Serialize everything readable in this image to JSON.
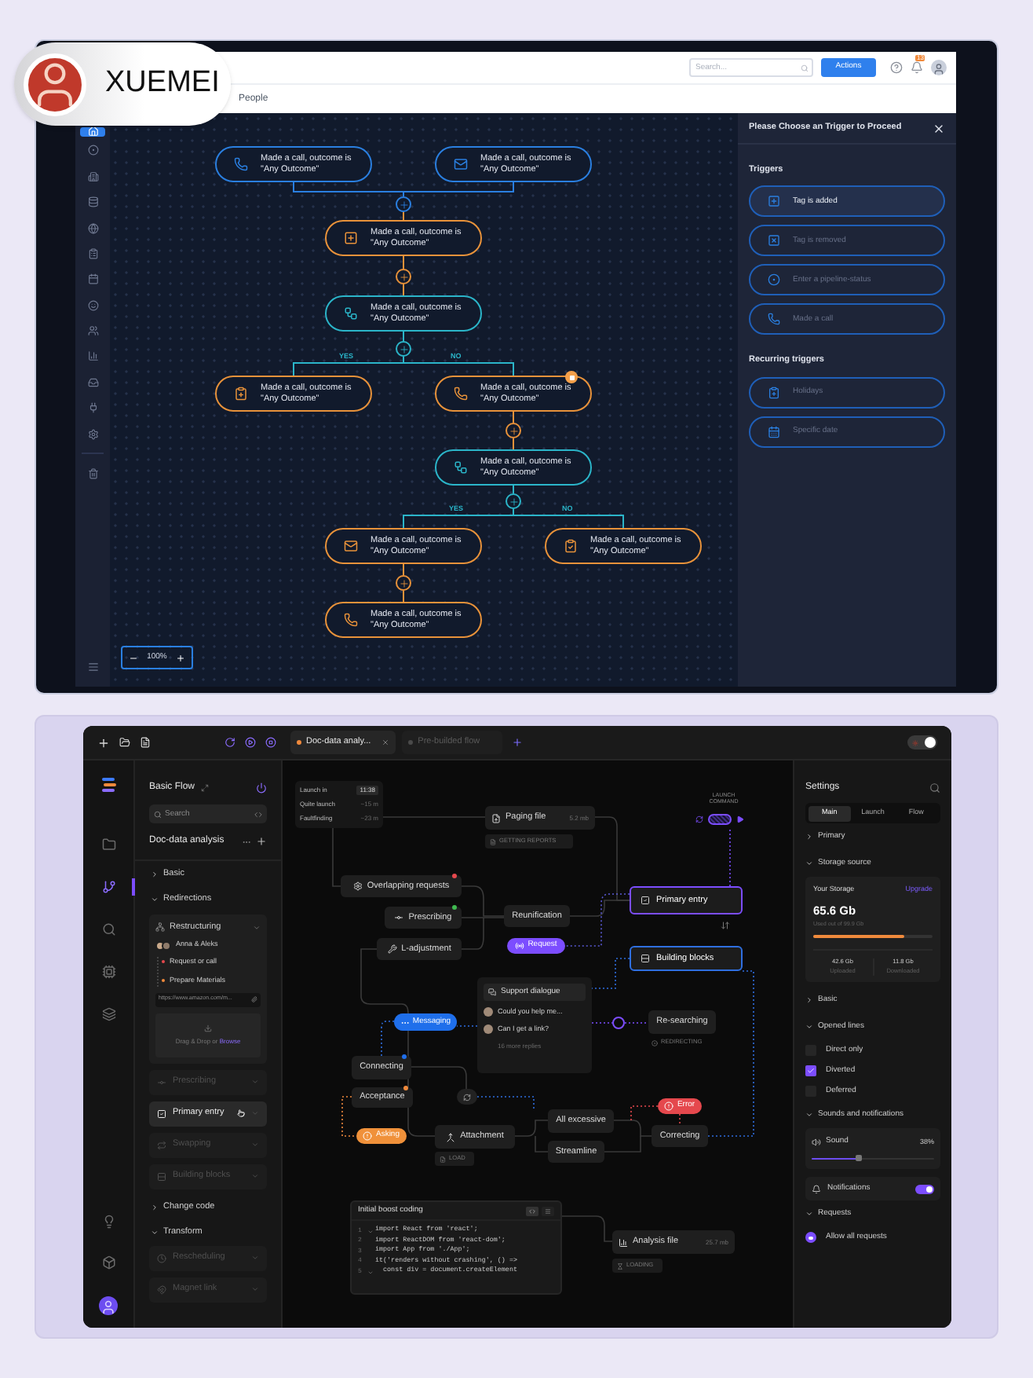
{
  "profile_badge": {
    "name": "XUEMEI"
  },
  "crm": {
    "search": {
      "placeholder": "Search..."
    },
    "actions_button": "Actions",
    "notification_count": "13",
    "breadcrumb": "People",
    "sidebar": [
      {
        "selected": true
      },
      {
        "selected": false
      },
      {
        "selected": false
      },
      {
        "selected": false
      },
      {
        "selected": false
      },
      {
        "selected": false
      },
      {
        "selected": false
      },
      {
        "selected": false
      },
      {
        "selected": false
      },
      {
        "selected": false
      },
      {
        "selected": false
      },
      {
        "selected": false
      },
      {
        "selected": false
      },
      {
        "selected": false
      }
    ],
    "flow": {
      "nodes": [
        {
          "kind": "call",
          "color": "#2a7fe0",
          "text": "Made a call, outcome is \"Any Outcome\"",
          "flagged": false
        },
        {
          "kind": "email",
          "color": "#2a7fe0",
          "text": "Made a call, outcome is \"Any Outcome\"",
          "flagged": false
        },
        {
          "kind": "tag",
          "color": "#e8923a",
          "text": "Made a call, outcome is \"Any Outcome\"",
          "flagged": false
        },
        {
          "kind": "split",
          "color": "#2bb5c9",
          "text": "Made a call, outcome is \"Any Outcome\"",
          "flagged": false
        },
        {
          "kind": "task",
          "color": "#e8923a",
          "text": "Made a call, outcome is \"Any Outcome\"",
          "flagged": false
        },
        {
          "kind": "call",
          "color": "#e8923a",
          "text": "Made a call, outcome is \"Any Outcome\"",
          "flagged": true
        },
        {
          "kind": "split",
          "color": "#2bb5c9",
          "text": "Made a call, outcome is \"Any Outcome\"",
          "flagged": false
        },
        {
          "kind": "email",
          "color": "#e8923a",
          "text": "Made a call, outcome is \"Any Outcome\"",
          "flagged": false
        },
        {
          "kind": "review",
          "color": "#e8923a",
          "text": "Made a call, outcome is \"Any Outcome\"",
          "flagged": false
        },
        {
          "kind": "call",
          "color": "#e8923a",
          "text": "Made a call, outcome is \"Any Outcome\"",
          "flagged": false
        }
      ],
      "branch_labels": [
        "YES",
        "NO",
        "YES",
        "NO"
      ],
      "zoom": "100%"
    },
    "trigger_panel": {
      "title": "Please Choose an Trigger to Proceed",
      "sections": [
        {
          "heading": "Triggers",
          "items": [
            {
              "label": "Tag is added",
              "selected": true
            },
            {
              "label": "Tag is removed",
              "selected": false
            },
            {
              "label": "Enter a pipeline-status",
              "selected": false
            },
            {
              "label": "Made a call",
              "selected": false
            }
          ]
        },
        {
          "heading": "Recurring triggers",
          "items": [
            {
              "label": "Holidays",
              "selected": false
            },
            {
              "label": "Specific date",
              "selected": false
            }
          ]
        }
      ]
    }
  },
  "studio": {
    "tabs": [
      {
        "label": "Doc-data analy...",
        "selected": true,
        "color": "#f08a3c",
        "closable": true
      },
      {
        "label": "Pre-builded flow",
        "selected": false,
        "color": "#4a4a4a",
        "closable": false
      }
    ],
    "theme_toggle": {
      "on": true
    },
    "rail": [
      {
        "selected": false
      },
      {
        "selected": true
      },
      {
        "selected": false
      },
      {
        "selected": false
      },
      {
        "selected": false
      }
    ],
    "panel": {
      "title": "Basic Flow",
      "search_placeholder": "Search",
      "project": "Doc-data analysis",
      "sections": [
        {
          "label": "Basic",
          "expanded": false
        },
        {
          "label": "Redirections",
          "expanded": true,
          "card": {
            "title": "Restructuring",
            "people": "Anna & Aleks",
            "steps": [
              {
                "label": "Request or call",
                "color": "#e5484d"
              },
              {
                "label": "Prepare Materials",
                "color": "#f08a3c"
              }
            ],
            "link": "https://www.amazon.com/m...",
            "dropzone": {
              "text": "Drag & Drop or",
              "link": "Browse"
            }
          },
          "items": [
            {
              "label": "Prescribing",
              "selected": false
            },
            {
              "label": "Primary entry",
              "selected": true
            },
            {
              "label": "Swapping",
              "selected": false
            },
            {
              "label": "Building blocks",
              "selected": false
            }
          ]
        },
        {
          "label": "Change code",
          "expanded": false
        },
        {
          "label": "Transform",
          "expanded": true,
          "items": [
            {
              "label": "Rescheduling",
              "selected": false
            },
            {
              "label": "Magnet link",
              "selected": false
            }
          ]
        }
      ]
    },
    "canvas": {
      "info": [
        {
          "label": "Launch in",
          "value": "11:38"
        },
        {
          "label": "Quite launch",
          "value": "~15 m"
        },
        {
          "label": "Faultfinding",
          "value": "~23 m"
        }
      ],
      "launch_label": "LAUNCH COMMAND",
      "launch_switch": {
        "on": true
      },
      "nodes": [
        {
          "kind": "file",
          "label": "Paging file",
          "meta": "5.2 mb"
        },
        {
          "kind": "tag",
          "label": "GETTING REPORTS"
        },
        {
          "kind": "node",
          "label": "Overlapping requests",
          "color": "#e5484d"
        },
        {
          "kind": "node",
          "label": "Prescribing",
          "color": "#3fb950"
        },
        {
          "kind": "node",
          "label": "Reunification"
        },
        {
          "kind": "node",
          "label": "L-adjustment"
        },
        {
          "kind": "pill",
          "label": "Request",
          "color": "#7c4dff"
        },
        {
          "kind": "entry",
          "label": "Primary entry",
          "color": "#7c4dff"
        },
        {
          "kind": "entry",
          "label": "Building blocks",
          "color": "#2f6fe0"
        },
        {
          "kind": "pill",
          "label": "Messaging",
          "color": "#1f6feb"
        },
        {
          "kind": "node",
          "label": "Re-searching"
        },
        {
          "kind": "status",
          "label": "REDIRECTING"
        },
        {
          "kind": "node",
          "label": "Connecting",
          "color": "#1f6feb"
        },
        {
          "kind": "node",
          "label": "Acceptance",
          "color": "#f08a3c"
        },
        {
          "kind": "pill",
          "label": "Asking",
          "color": "#f0913a"
        },
        {
          "kind": "node",
          "label": "Attachment"
        },
        {
          "kind": "tag",
          "label": "LOAD"
        },
        {
          "kind": "node",
          "label": "All excessive"
        },
        {
          "kind": "node",
          "label": "Streamline"
        },
        {
          "kind": "pill",
          "label": "Error",
          "color": "#e5484d"
        },
        {
          "kind": "node",
          "label": "Correcting"
        },
        {
          "kind": "file",
          "label": "Analysis file",
          "meta": "25.7 mb"
        },
        {
          "kind": "tag",
          "label": "LOADING"
        }
      ],
      "thread": {
        "title": "Support dialogue",
        "messages": [
          "Could you help me...",
          "Can I get a link?"
        ],
        "more": "16 more replies"
      },
      "code": {
        "title": "Initial boost coding",
        "lines": [
          {
            "num": "1",
            "text": "import React from 'react';",
            "foldable": true
          },
          {
            "num": "2",
            "text": "import ReactDOM from 'react-dom';",
            "foldable": false
          },
          {
            "num": "3",
            "text": "import App from './App';",
            "foldable": false
          },
          {
            "num": "4",
            "text": "it('renders without crashing', () =>",
            "foldable": false
          },
          {
            "num": "5",
            "text": "  const div = document.createElement",
            "foldable": true
          }
        ]
      }
    },
    "settings": {
      "title": "Settings",
      "tabs": [
        {
          "label": "Main",
          "selected": true
        },
        {
          "label": "Launch",
          "selected": false
        },
        {
          "label": "Flow",
          "selected": false
        }
      ],
      "sections": [
        {
          "kind": "header",
          "label": "Primary",
          "expanded": false
        },
        {
          "kind": "header",
          "label": "Storage source",
          "expanded": true
        },
        {
          "kind": "storage",
          "title": "Your Storage",
          "action": "Upgrade",
          "amount": "65.6 Gb",
          "caption": "Used out of 99.9 Gb",
          "level": 0.76,
          "stats": [
            {
              "value": "42.6 Gb",
              "label": "Uploaded"
            },
            {
              "value": "11.8 Gb",
              "label": "Downloaded"
            }
          ]
        },
        {
          "kind": "header",
          "label": "Basic",
          "expanded": false
        },
        {
          "kind": "header",
          "label": "Opened lines",
          "expanded": true
        },
        {
          "kind": "checkbox",
          "label": "Direct only",
          "checked": false
        },
        {
          "kind": "checkbox",
          "label": "Diverted",
          "checked": true
        },
        {
          "kind": "checkbox",
          "label": "Deferred",
          "checked": false
        },
        {
          "kind": "header",
          "label": "Sounds and notifications",
          "expanded": true
        },
        {
          "kind": "slider",
          "label": "Sound",
          "reading": "38%",
          "level": 0.38
        },
        {
          "kind": "toggle",
          "label": "Notifications",
          "on": true
        },
        {
          "kind": "header",
          "label": "Requests",
          "expanded": true
        },
        {
          "kind": "radio",
          "label": "Allow all requests",
          "selected": true
        }
      ]
    }
  }
}
